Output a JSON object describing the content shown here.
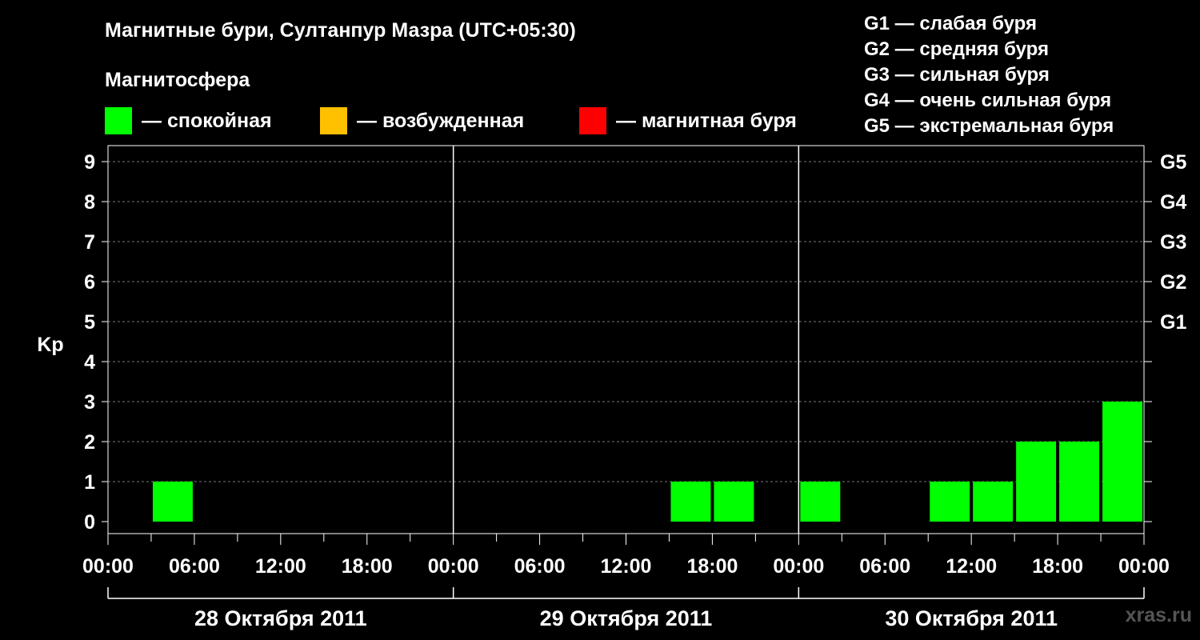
{
  "title": "Магнитные бури, Султанпур Мазра (UTC+05:30)",
  "magnetosphere": {
    "title": "Магнитосфера",
    "legend": [
      {
        "label": "— спокойная",
        "color": "#00ff00"
      },
      {
        "label": "— возбужденная",
        "color": "#ffc000"
      },
      {
        "label": "— магнитная буря",
        "color": "#ff0000"
      }
    ]
  },
  "g_scale": [
    "G1 — слабая буря",
    "G2 — средняя буря",
    "G3 — сильная буря",
    "G4 — очень сильная буря",
    "G5 — экстремальная буря"
  ],
  "watermark": "xras.ru",
  "chart_data": {
    "type": "bar",
    "ylabel": "Kp",
    "ylim": [
      0,
      9
    ],
    "yticks": [
      0,
      1,
      2,
      3,
      4,
      5,
      6,
      7,
      8,
      9
    ],
    "right_axis_labels": [
      {
        "kp": 5,
        "label": "G1"
      },
      {
        "kp": 6,
        "label": "G2"
      },
      {
        "kp": 7,
        "label": "G3"
      },
      {
        "kp": 8,
        "label": "G4"
      },
      {
        "kp": 9,
        "label": "G5"
      }
    ],
    "x_tick_labels": [
      "00:00",
      "06:00",
      "12:00",
      "18:00",
      "00:00",
      "06:00",
      "12:00",
      "18:00",
      "00:00",
      "06:00",
      "12:00",
      "18:00",
      "00:00"
    ],
    "days": [
      "28 Октября 2011",
      "29 Октября 2011",
      "30 Октября 2011"
    ],
    "interval_hours": 3,
    "values": [
      [
        0,
        1,
        0,
        0,
        0,
        0,
        0,
        0
      ],
      [
        0,
        0,
        0,
        0,
        0,
        1,
        1,
        0
      ],
      [
        1,
        0,
        0,
        1,
        1,
        2,
        2,
        3
      ]
    ],
    "last_partial_value": 1,
    "grid": "dashed horizontal",
    "bar_color": "#00ff00"
  }
}
